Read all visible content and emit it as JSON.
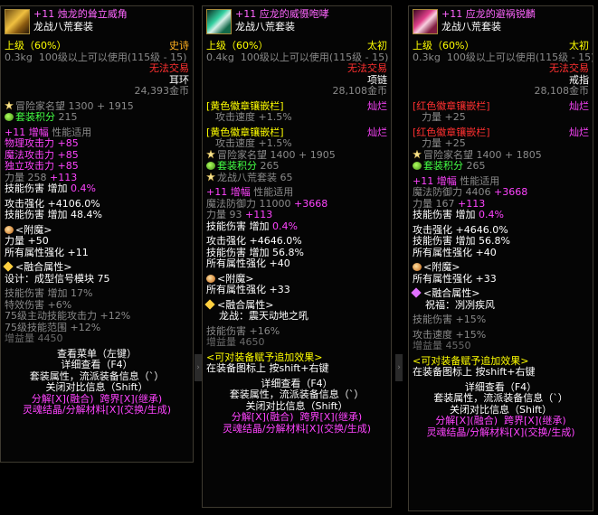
{
  "panels": [
    {
      "title": "+11 烛龙的耸立威角",
      "set": "龙战八荒套装",
      "grade": "上级（60%）",
      "rarity": "史诗",
      "weight": "0.3kg",
      "level_req": "100级以上可以使用(115级 - 15)",
      "trade": "无法交易",
      "slot": "耳环",
      "price": "24,393金币",
      "fame_label": "冒险家名望",
      "fame_value": "1300 + 1915",
      "set_points_label": "套装积分",
      "set_points_value": "215",
      "amp_prefix": "+11",
      "amp_label": "增幅",
      "amp_note": "性能适用",
      "amp_lines": [
        {
          "label": "物理攻击力",
          "value": "+85"
        },
        {
          "label": "魔法攻击力",
          "value": "+85"
        },
        {
          "label": "独立攻击力",
          "value": "+85"
        }
      ],
      "str_label": "力量",
      "str_base": "258",
      "str_bonus": "+113",
      "skill_dmg": "技能伤害",
      "skill_inc": "增加",
      "skill_val": "0.4%",
      "atk_bonus": "攻击强化 +4106.0%",
      "skill_dmg2_label": "技能伤害",
      "skill_dmg2_inc": "增加",
      "skill_dmg2_val": "48.4%",
      "enchant_label": "<附魔>",
      "enchant_lines": [
        "力量 +50",
        "所有属性强化 +11"
      ],
      "fusion_label": "<融合属性>",
      "fusion_design": "设计：成型信号模块 75",
      "fusion_stats": [
        "技能伤害 增加 17%",
        "特效伤害 +6%",
        "75级主动技能攻击力 +12%",
        "75级技能范围 +12%"
      ],
      "fusion_stat_labels": [
        "增益量 4450"
      ],
      "actions": [
        "查看菜单（左键）",
        "详细查看（F4）",
        "套装属性，流派装备信息（`）",
        "关闭对比信息（Shift）"
      ],
      "disassemble": "分解[X](融合)",
      "crossworld": "跨界[X](继承)",
      "soul": "灵魂结晶/分解材料[X](交换/生成)"
    },
    {
      "title": "+11 应龙的威慑咆哮",
      "set": "龙战八荒套装",
      "grade": "上级（60%）",
      "rarity": "太初",
      "weight": "0.4kg",
      "level_req": "100级以上可以使用(115级 - 15)",
      "trade": "无法交易",
      "slot": "项链",
      "price": "28,108金币",
      "emblem1": "[黄色徽章镶嵌栏]",
      "emblem1_tag": "灿烂",
      "emblem1_stat": "攻击速度 +1.5%",
      "emblem2": "[黄色徽章镶嵌栏]",
      "emblem2_tag": "灿烂",
      "emblem2_stat": "攻击速度 +1.5%",
      "fame_label": "冒险家名望",
      "fame_value": "1400 + 1905",
      "set_points_label": "套装积分",
      "set_points_value": "265",
      "set_name_line": "龙战八荒套装 65",
      "amp_prefix": "+11",
      "amp_label": "增幅",
      "amp_note": "性能适用",
      "mdef": "魔法防御力 11000",
      "mdef_bonus": "+3668",
      "str_label": "力量",
      "str_base": "93",
      "str_bonus": "+113",
      "skill_dmg": "技能伤害",
      "skill_inc": "增加",
      "skill_val": "0.4%",
      "atk_bonus": "攻击强化 +4646.0%",
      "skill_dmg2_label": "技能伤害",
      "skill_dmg2_inc": "增加",
      "skill_dmg2_val": "56.8%",
      "all_stat": "所有属性强化 +40",
      "enchant_label": "<附魔>",
      "enchant_line": "所有属性强化 +33",
      "fusion_label": "<融合属性>",
      "fusion_name": "龙战：震天动地之吼",
      "fusion_stats": [
        "技能伤害 +16%",
        "增益量 4650"
      ],
      "tradable": "<可对装备赋予追加效果>",
      "tradable_hint": "在装备图标上 按shift+右键",
      "actions": [
        "详细查看（F4）",
        "套装属性，流派装备信息（`）",
        "关闭对比信息（Shift）"
      ],
      "disassemble": "分解[X](融合)",
      "crossworld": "跨界[X](继承)",
      "soul": "灵魂结晶/分解材料[X](交换/生成)"
    },
    {
      "title": "+11 应龙的避祸锐麟",
      "set": "龙战八荒套装",
      "grade": "上级（60%）",
      "rarity": "太初",
      "weight": "0.3kg",
      "level_req": "100级以上可以使用(115级 - 15)",
      "trade": "无法交易",
      "slot": "戒指",
      "price": "28,108金币",
      "emblem1": "[红色徽章镶嵌栏]",
      "emblem1_tag": "灿烂",
      "emblem1_stat": "力量 +25",
      "emblem2": "[红色徽章镶嵌栏]",
      "emblem2_tag": "灿烂",
      "emblem2_stat": "力量 +25",
      "fame_label": "冒险家名望",
      "fame_value": "1400 + 1805",
      "set_points_label": "套装积分",
      "set_points_value": "265",
      "amp_prefix": "+11",
      "amp_label": "增幅",
      "amp_note": "性能适用",
      "mdef": "魔法防御力 4406",
      "mdef_bonus": "+3668",
      "str_label": "力量",
      "str_base": "167",
      "str_bonus": "+113",
      "skill_dmg": "技能伤害",
      "skill_inc": "增加",
      "skill_val": "0.4%",
      "atk_bonus": "攻击强化 +4646.0%",
      "skill_dmg2_label": "技能伤害",
      "skill_dmg2_inc": "增加",
      "skill_dmg2_val": "56.8%",
      "all_stat": "所有属性强化 +40",
      "enchant_label": "<附魔>",
      "enchant_line": "所有属性强化 +33",
      "fusion_label": "<融合属性>",
      "fusion_name": "祝福：冽冽疾风",
      "fusion_stats": [
        "技能伤害 +15%",
        "攻击速度 +15%",
        "增益量 4550"
      ],
      "tradable": "<可对装备赋予追加效果>",
      "tradable_hint": "在装备图标上 按shift+右键",
      "actions": [
        "详细查看（F4）",
        "套装属性，流派装备信息（`）",
        "关闭对比信息（Shift）"
      ],
      "disassemble": "分解[X](融合)",
      "crossworld": "跨界[X](继承)",
      "soul": "灵魂结晶/分解材料[X](交换/生成)"
    }
  ],
  "colors": {
    "title": "#ff66ff",
    "rarity_epic": "#ffb020",
    "rarity_primal": "#ffff00",
    "warning": "#ff3030"
  }
}
